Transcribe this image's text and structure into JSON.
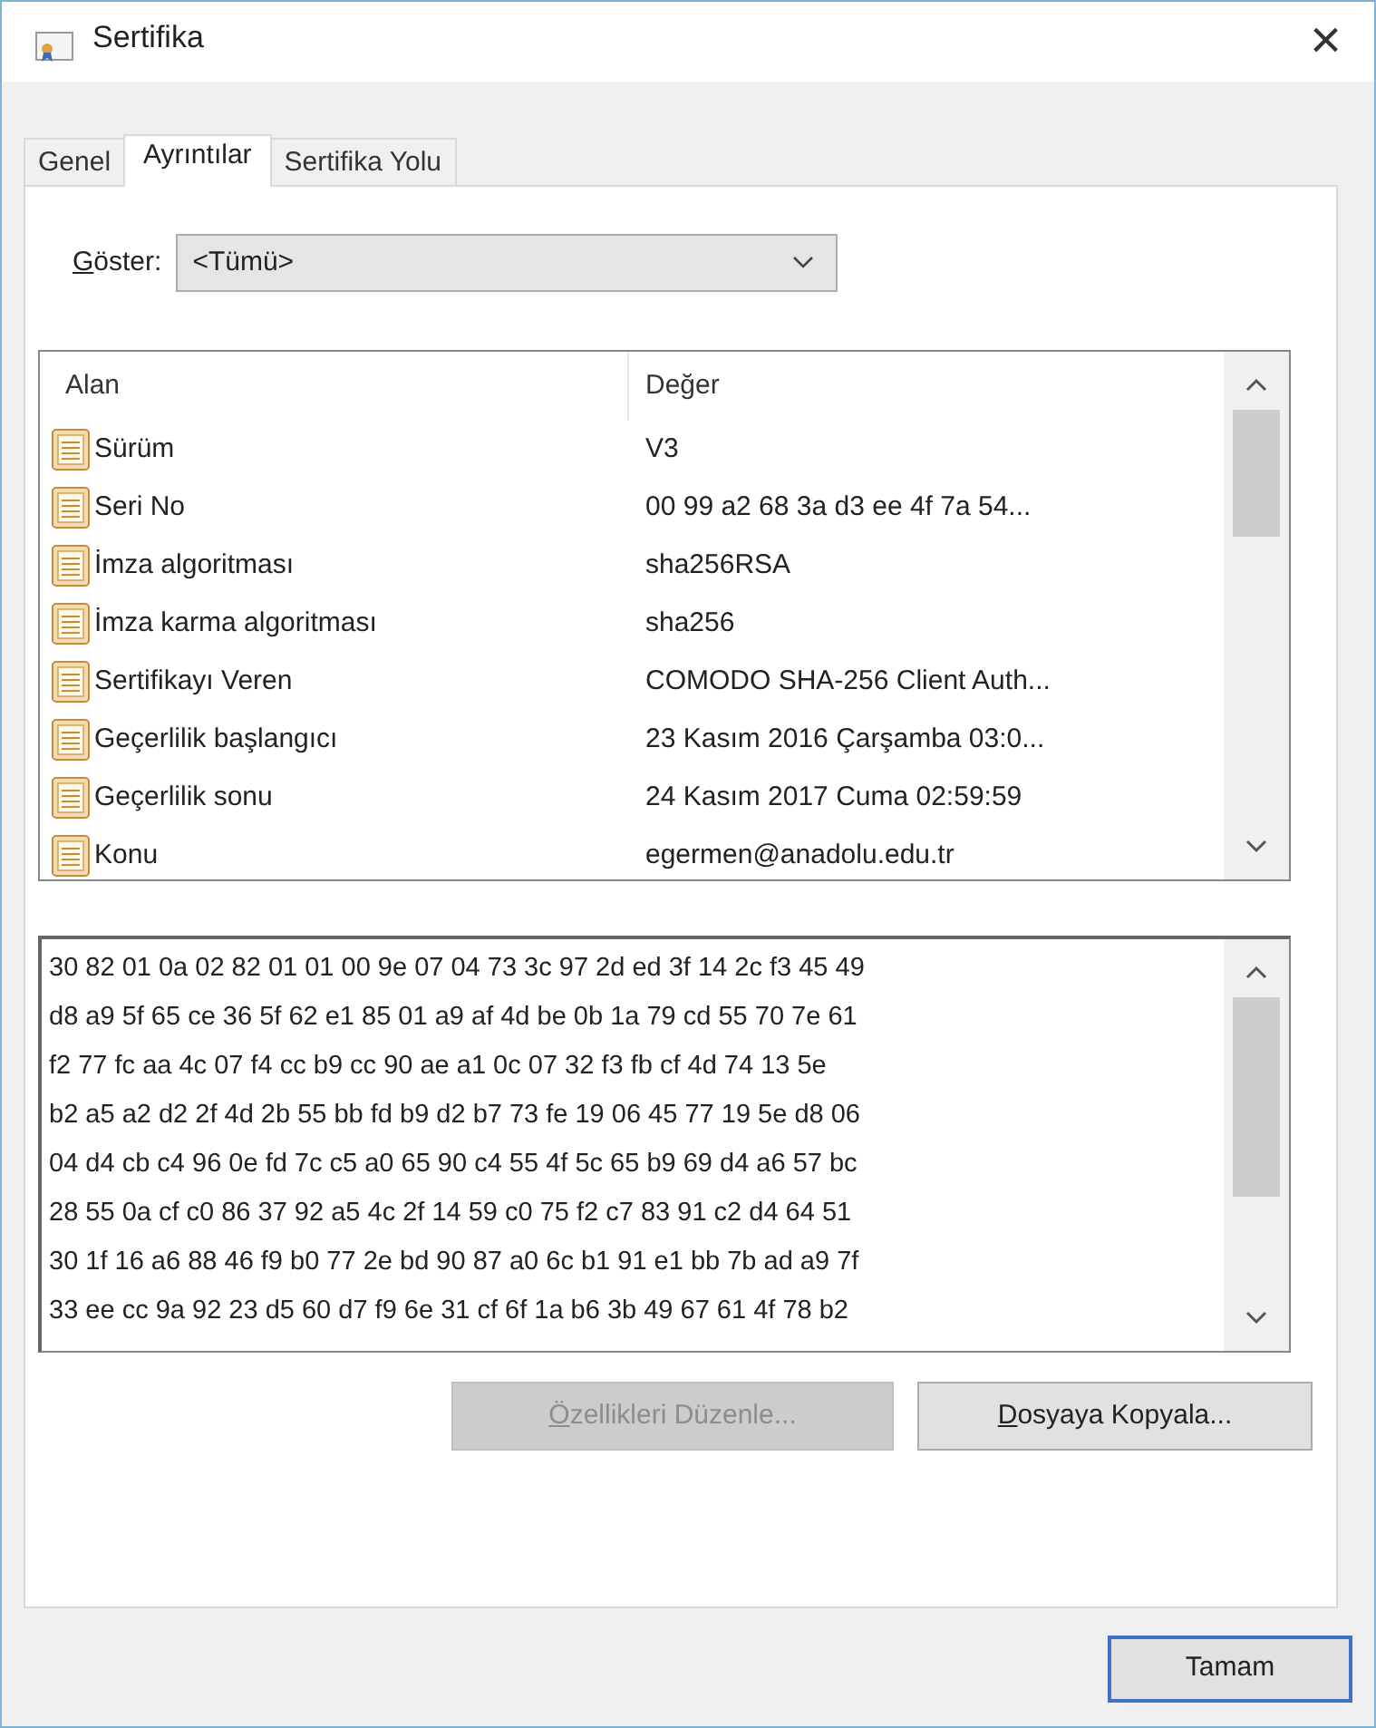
{
  "window": {
    "title": "Sertifika",
    "close": "×"
  },
  "tabs": [
    {
      "label": "Genel",
      "selected": false
    },
    {
      "label": "Ayrıntılar",
      "selected": true
    },
    {
      "label": "Sertifika Yolu",
      "selected": false
    }
  ],
  "show": {
    "label": "Göster:",
    "value": "<Tümü>"
  },
  "fields": {
    "columns": [
      "Alan",
      "Değer"
    ],
    "rows": [
      {
        "field": "Sürüm",
        "value": "V3"
      },
      {
        "field": "Seri No",
        "value": "00 99 a2 68 3a d3 ee 4f 7a 54..."
      },
      {
        "field": "İmza algoritması",
        "value": "sha256RSA"
      },
      {
        "field": "İmza karma algoritması",
        "value": "sha256"
      },
      {
        "field": "Sertifikayı Veren",
        "value": "COMODO SHA-256 Client Auth..."
      },
      {
        "field": "Geçerlilik başlangıcı",
        "value": "23 Kasım 2016 Çarşamba 03:0..."
      },
      {
        "field": "Geçerlilik sonu",
        "value": "24 Kasım 2017 Cuma 02:59:59"
      },
      {
        "field": "Konu",
        "value": "egermen@anadolu.edu.tr"
      }
    ]
  },
  "detail_lines": [
    "30 82 01 0a 02 82 01 01 00 9e 07 04 73 3c 97 2d ed 3f 14 2c f3 45 49",
    "d8 a9 5f 65 ce 36 5f 62 e1 85 01 a9 af 4d be 0b 1a 79 cd 55 70 7e 61",
    "f2 77 fc aa 4c 07 f4 cc b9 cc 90 ae a1 0c 07 32 f3 fb cf 4d 74 13 5e",
    "b2 a5 a2 d2 2f 4d 2b 55 bb fd b9 d2 b7 73 fe 19 06 45 77 19 5e d8 06",
    "04 d4 cb c4 96 0e fd 7c c5 a0 65 90 c4 55 4f 5c 65 b9 69 d4 a6 57 bc",
    "28 55 0a cf c0 86 37 92 a5 4c 2f 14 59 c0 75 f2 c7 83 91 c2 d4 64 51",
    "30 1f 16 a6 88 46 f9 b0 77 2e bd 90 87 a0 6c b1 91 e1 bb 7b ad a9 7f",
    "33 ee cc 9a 92 23 d5 60 d7 f9 6e 31 cf 6f 1a b6 3b 49 67 61 4f 78 b2"
  ],
  "buttons": [
    {
      "label": "Özellikleri Düzenle...",
      "disabled": true
    },
    {
      "label": "Dosyaya Kopyala...",
      "disabled": false
    }
  ],
  "ok_button": "Tamam"
}
